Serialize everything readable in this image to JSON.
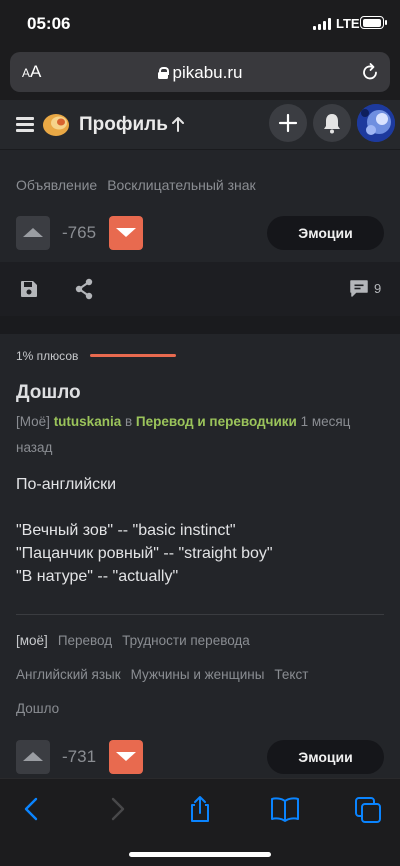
{
  "status_bar": {
    "time": "05:06",
    "network": "LTE"
  },
  "browser": {
    "text_size_label": "AA",
    "url": "pikabu.ru"
  },
  "header": {
    "title": "Профиль"
  },
  "post1": {
    "tags": [
      "Объявление",
      "Восклицательный знак"
    ],
    "rating": "-765",
    "emotions_label": "Эмоции",
    "comments_count": "9"
  },
  "post2": {
    "rating_text": "1% плюсов",
    "rating_fraction": 0.01,
    "title": "Дошло",
    "tag_mine": "[Моё]",
    "author": "tutuskania",
    "in_word": "в",
    "community": "Перевод и переводчики",
    "time_ago": "1 месяц назад",
    "body": {
      "line1": "По-английски",
      "line2": "\"Вечный зов\"  -- \"basic instinct\"",
      "line3": "\"Пацанчик ровный\" -- \"straight boy\"",
      "line4": "\"В натуре\" -- \"actually\""
    },
    "tags": {
      "row1": [
        "[моё]",
        "Перевод",
        "Трудности перевода"
      ],
      "row2": [
        "Английский язык",
        "Мужчины и женщины",
        "Текст"
      ],
      "row3": [
        "Дошло"
      ]
    },
    "rating": "-731",
    "emotions_label": "Эмоции"
  },
  "colors": {
    "accent_red": "#e86a4f",
    "accent_green": "#9bc45b",
    "ios_blue": "#0a84ff"
  }
}
